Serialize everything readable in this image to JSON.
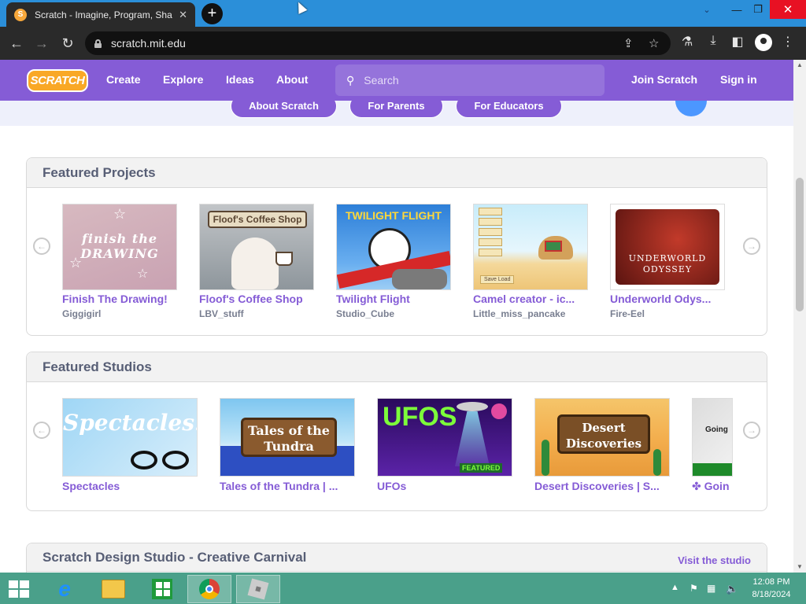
{
  "browser": {
    "tab_title": "Scratch - Imagine, Program, Sha",
    "tab_close": "✕",
    "new_tab": "+",
    "url": "scratch.mit.edu",
    "window_min": "—",
    "window_restore": "❐",
    "window_close": "✕"
  },
  "scratch_nav": {
    "logo": "SCRATCH",
    "links": [
      "Create",
      "Explore",
      "Ideas",
      "About"
    ],
    "search_placeholder": "Search",
    "join": "Join Scratch",
    "signin": "Sign in"
  },
  "banner": {
    "buttons": [
      "About Scratch",
      "For Parents",
      "For Educators"
    ]
  },
  "featured_projects": {
    "title": "Featured Projects",
    "items": [
      {
        "title": "Finish The Drawing!",
        "author": "Giggigirl",
        "thumb_text": "finish the DRAWING"
      },
      {
        "title": "Floof's Coffee Shop",
        "author": "LBV_stuff",
        "thumb_text": "Floof's Coffee Shop"
      },
      {
        "title": "Twilight Flight",
        "author": "Studio_Cube",
        "thumb_text": "TWILIGHT FLIGHT"
      },
      {
        "title": "Camel creator - ic...",
        "author": "Little_miss_pancake",
        "thumb_text": "Save Load"
      },
      {
        "title": "Underworld Odys...",
        "author": "Fire-Eel",
        "thumb_text": "UNDERWORLD ODYSSEY"
      }
    ]
  },
  "featured_studios": {
    "title": "Featured Studios",
    "items": [
      {
        "title": "Spectacles",
        "thumb_text": "Spectacles!"
      },
      {
        "title": "Tales of the Tundra | ...",
        "thumb_text": "Tales of the Tundra"
      },
      {
        "title": "UFOs",
        "thumb_text": "UFOS"
      },
      {
        "title": "Desert Discoveries | S...",
        "thumb_text": "Desert Discoveries"
      },
      {
        "title": "✤ Goin",
        "thumb_text": "Going"
      }
    ]
  },
  "design_studio": {
    "title": "Scratch Design Studio - Creative Carnival",
    "link": "Visit the studio"
  },
  "taskbar": {
    "time": "12:08 PM",
    "date": "8/18/2024"
  }
}
